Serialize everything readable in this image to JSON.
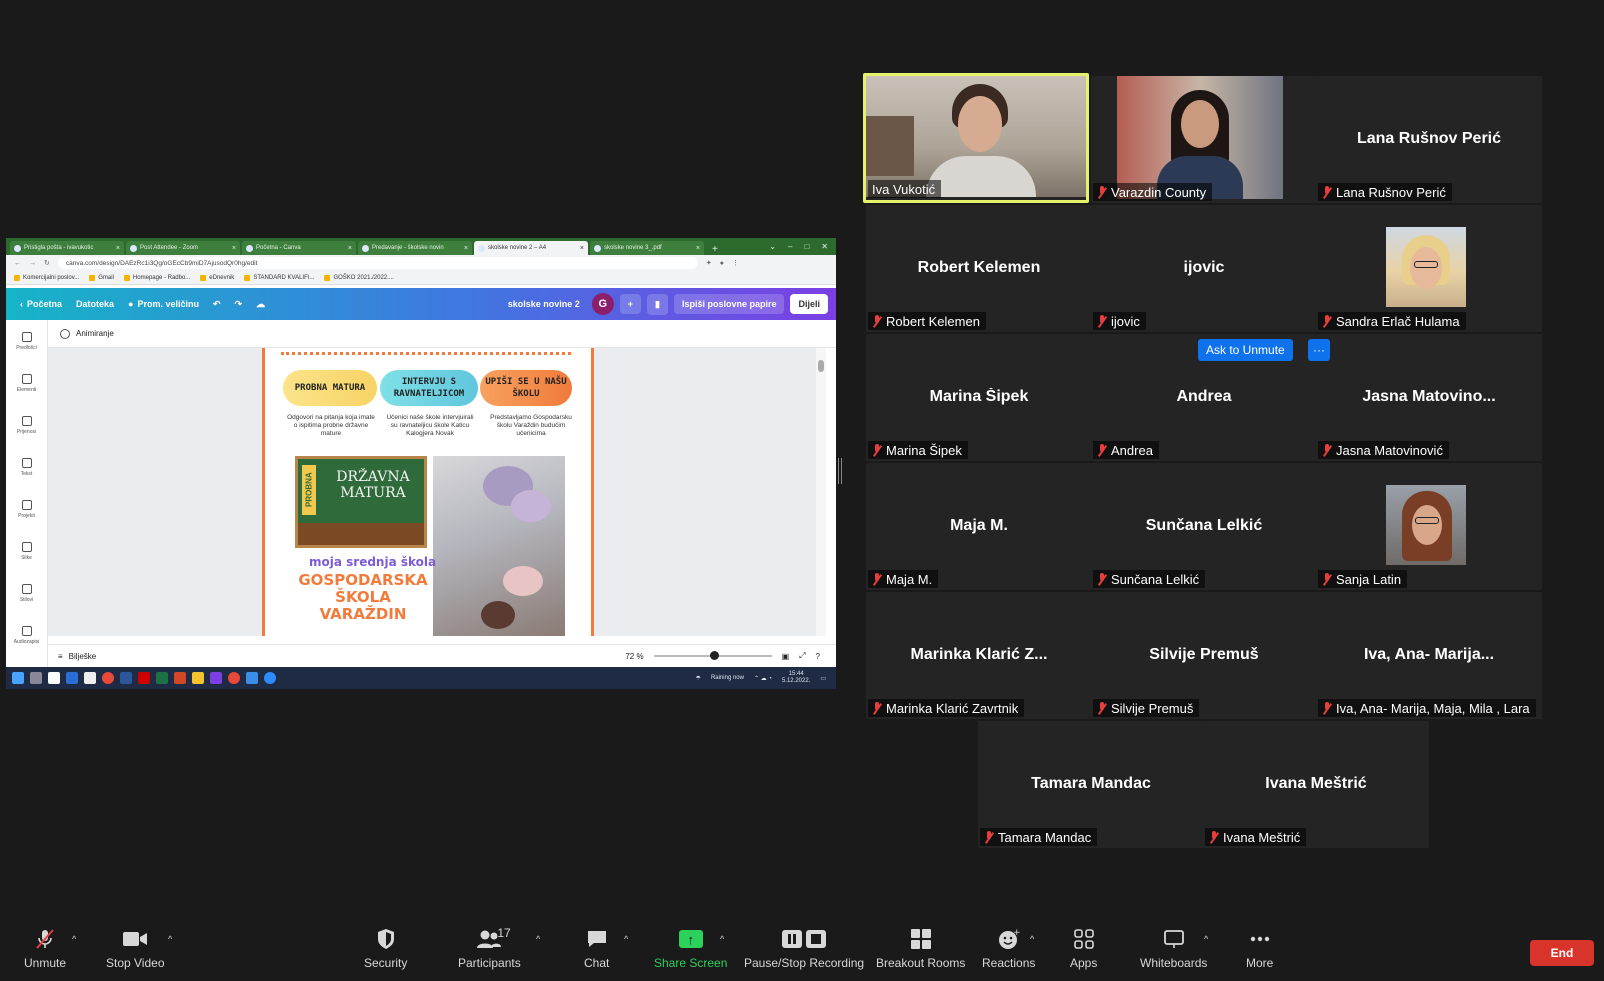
{
  "shared_screen": {
    "browser_tabs": [
      "Pristigla pošta - ivavukotic",
      "Post Attendee - Zoom",
      "Početna - Canva",
      "Predavanje - školske novin",
      "skolske novine 2 – A4",
      "skolske novine 3_.pdf"
    ],
    "address_url": "canva.com/design/DAEzRc1i3Qg/oGEcCb9miD7AjusodQr0hg/edit",
    "bookmarks": [
      "Komercijalni poslov...",
      "Gmail",
      "Homepage - Radbo...",
      "eDnevnik",
      "STANDARD KVALIFI...",
      "GOŠKO 2021./2022...."
    ],
    "canva_top": {
      "home": "Početna",
      "file": "Datoteka",
      "resize": "Prom. veličinu",
      "title": "skolske novine 2",
      "avatar": "G",
      "print": "Ispiši poslovne papire",
      "share": "Dijeli"
    },
    "sidebar": [
      "Predlošci",
      "Elementi",
      "Prijenosi",
      "Tekst",
      "Projekti",
      "Slike",
      "Stilovi",
      "Audiozapisi"
    ],
    "animate": "Animiranje",
    "poster": {
      "pills": [
        "PROBNA MATURA",
        "INTERVJU S RAVNATELJICOM",
        "UPIŠI SE U NAŠU ŠKOLU"
      ],
      "descriptions": [
        "Odgovori na pitanja koja imate o ispitima probne državne mature",
        "Učenici naše škole intervjuirali su ravnateljicu škole Katicu Kalogjera Novak",
        "Predstavljamo Gospodarsku školu Varaždin budućim učenicima"
      ],
      "board_side": "PROBNA",
      "board_text": "DRŽAVNA MATURA",
      "moja": "moja srednja škola",
      "school": "GOSPODARSKA ŠKOLA VARAŽDIN"
    },
    "notes": "Bilješke",
    "zoom": "72 %",
    "taskbar": {
      "weather": "Raining now",
      "time": "15:44",
      "date": "5.12.2022."
    }
  },
  "tiles": [
    {
      "center": "",
      "label": "Iva Vukotić",
      "muted": false,
      "active": true
    },
    {
      "center": "",
      "label": "Varazdin County",
      "muted": true,
      "active": false
    },
    {
      "center": "Lana Rušnov Perić",
      "label": "Lana Rušnov Perić",
      "muted": true
    },
    {
      "center": "Robert Kelemen",
      "label": "Robert Kelemen",
      "muted": true
    },
    {
      "center": "ijovic",
      "label": "ijovic",
      "muted": true
    },
    {
      "center": "",
      "label": "Sandra Erlač Hulama",
      "muted": true
    },
    {
      "center": "Marina Šipek",
      "label": "Marina Šipek",
      "muted": true
    },
    {
      "center": "Andrea",
      "label": "Andrea",
      "muted": true
    },
    {
      "center": "Jasna  Matovino...",
      "label": "Jasna Matovinović",
      "muted": true
    },
    {
      "center": "Maja M.",
      "label": "Maja M.",
      "muted": true
    },
    {
      "center": "Sunčana Lelkić",
      "label": "Sunčana Lelkić",
      "muted": true
    },
    {
      "center": "",
      "label": "Sanja Latin",
      "muted": true
    },
    {
      "center": "Marinka  Klarić  Z...",
      "label": "Marinka Klarić Zavrtnik",
      "muted": true
    },
    {
      "center": "Silvije Premuš",
      "label": "Silvije Premuš",
      "muted": true
    },
    {
      "center": "Iva,  Ana-  Marija...",
      "label": "Iva, Ana- Marija, Maja, Mila , Lara",
      "muted": true
    },
    {
      "center": "Tamara Mandac",
      "label": "Tamara Mandac",
      "muted": true
    },
    {
      "center": "Ivana Meštrić",
      "label": "Ivana Meštrić",
      "muted": true
    }
  ],
  "ask_unmute": "Ask to Unmute",
  "more_dots": "···",
  "toolbar": {
    "unmute": "Unmute",
    "stop_video": "Stop Video",
    "security": "Security",
    "participants": "Participants",
    "participants_count": "17",
    "chat": "Chat",
    "share_screen": "Share Screen",
    "recording": "Pause/Stop Recording",
    "breakout": "Breakout Rooms",
    "reactions": "Reactions",
    "apps": "Apps",
    "whiteboards": "Whiteboards",
    "more": "More",
    "end": "End"
  },
  "colors": {
    "active_speaker": "#e6f26a",
    "share_green": "#2dd05b",
    "end_red": "#d9342b",
    "zoom_blue": "#0e72ed"
  }
}
